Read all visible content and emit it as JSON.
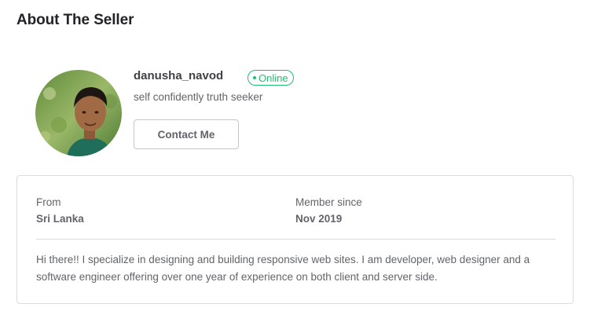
{
  "section": {
    "title": "About The Seller"
  },
  "seller": {
    "avatar_icon": "profile-photo",
    "username": "danusha_navod",
    "status": "Online",
    "tagline": "self confidently truth seeker",
    "contact_label": "Contact Me"
  },
  "stats": {
    "from_label": "From",
    "from_value": "Sri Lanka",
    "member_label": "Member since",
    "member_value": "Nov 2019"
  },
  "description": "Hi there!! I specialize in designing and building responsive web sites. I am developer, web designer and a software engineer offering over one year of experience on both client and server side.",
  "colors": {
    "accent_online": "#1dbf73",
    "text_primary": "#404145",
    "text_secondary": "#62646a",
    "border": "#dadbdd"
  }
}
